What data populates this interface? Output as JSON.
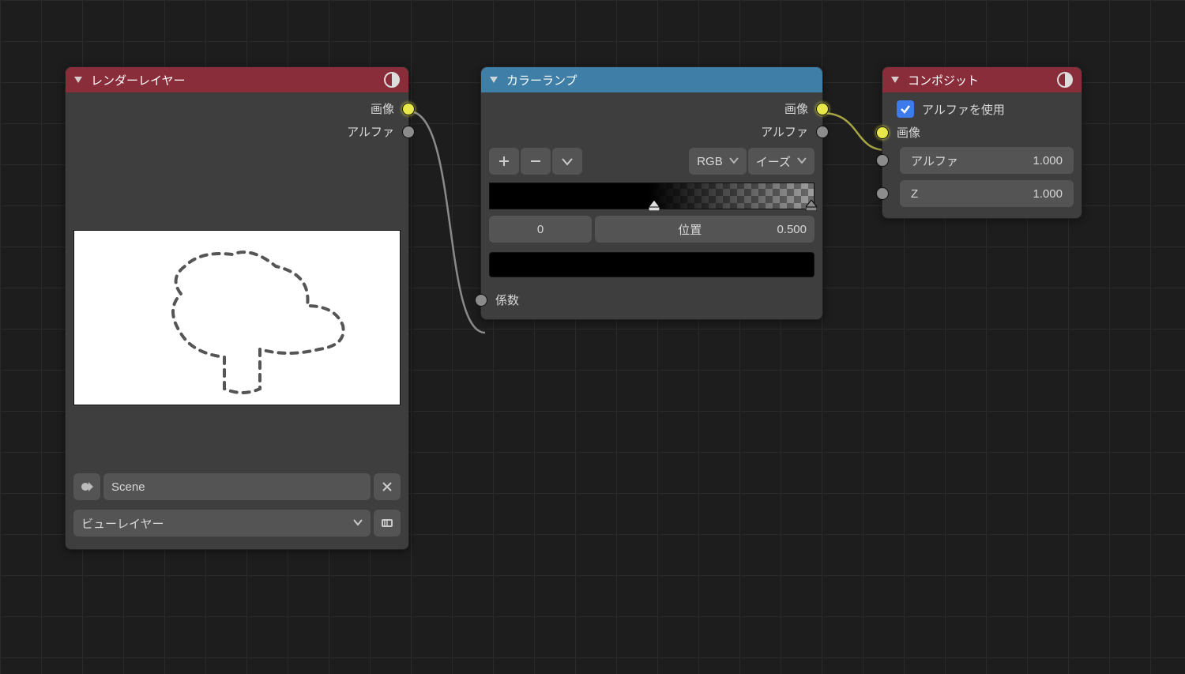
{
  "node1": {
    "title": "レンダーレイヤー",
    "out_image": "画像",
    "out_alpha": "アルファ",
    "scene": "Scene",
    "viewlayer": "ビューレイヤー"
  },
  "node2": {
    "title": "カラーランプ",
    "out_image": "画像",
    "out_alpha": "アルファ",
    "mode": "RGB",
    "interp": "イーズ",
    "stop_index": "0",
    "pos_label": "位置",
    "pos_value": "0.500",
    "in_fac": "係数"
  },
  "node3": {
    "title": "コンポジット",
    "use_alpha": "アルファを使用",
    "in_image": "画像",
    "alpha_label": "アルファ",
    "alpha_val": "1.000",
    "z_label": "Z",
    "z_val": "1.000"
  }
}
